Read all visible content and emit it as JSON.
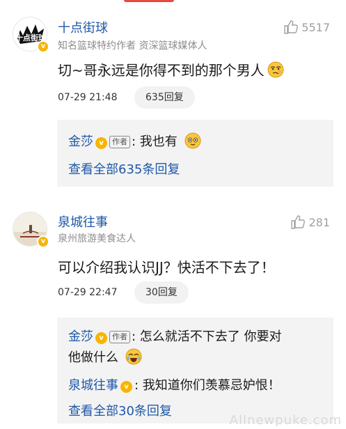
{
  "comments": [
    {
      "username": "十点街球",
      "title": "知名篮球特约作者 资深篮球媒体人",
      "likes": "5517",
      "text": "切~哥永远是你得不到的那个男人",
      "time": "07-29 21:48",
      "reply_count_label": "635回复",
      "avatar_text": "十点街球",
      "replies": [
        {
          "name": "金莎",
          "tag": "作者",
          "text": "我也有"
        }
      ],
      "view_all": "查看全部635条回复"
    },
    {
      "username": "泉城往事",
      "title": "泉州旅游美食达人",
      "likes": "281",
      "text": "可以介绍我认识JJ？快活不下去了！",
      "time": "07-29 22:47",
      "reply_count_label": "30回复",
      "replies": [
        {
          "name": "金莎",
          "tag": "作者",
          "text_line1": "怎么就活不下去了 你要对",
          "text_line2": "他做什么"
        },
        {
          "name": "泉城往事",
          "text": "我知道你们羡慕忌妒恨！"
        }
      ],
      "view_all": "查看全部30条回复"
    }
  ],
  "verified_mark": "v",
  "watermark": "Allnewpuke.com",
  "colors": {
    "link": "#1f58a8",
    "badge": "#f7b500",
    "tab_indicator": "#e8483b"
  }
}
